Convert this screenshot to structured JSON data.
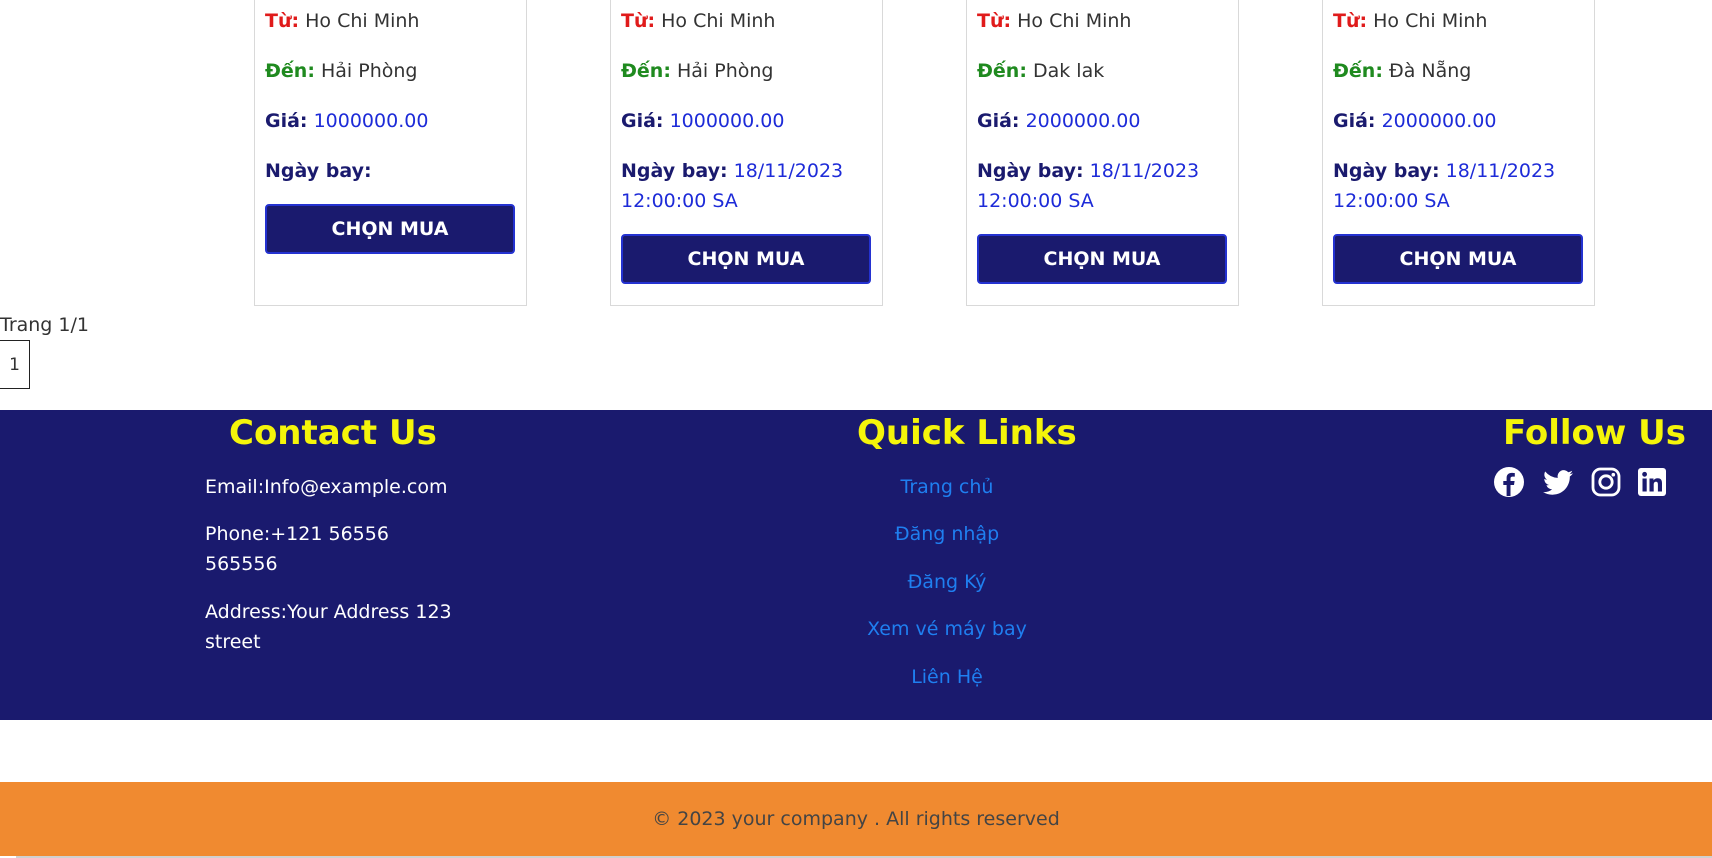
{
  "tickets": [
    {
      "from_label": "Từ:",
      "from": "Ho Chi Minh",
      "to_label": "Đến:",
      "to": "Hải Phòng",
      "price_label": "Giá:",
      "price": "1000000.00",
      "date_label": "Ngày bay:",
      "date": "",
      "button": "CHỌN MUA"
    },
    {
      "from_label": "Từ:",
      "from": "Ho Chi Minh",
      "to_label": "Đến:",
      "to": "Hải Phòng",
      "price_label": "Giá:",
      "price": "1000000.00",
      "date_label": "Ngày bay:",
      "date": "18/11/2023 12:00:00 SA",
      "button": "CHỌN MUA"
    },
    {
      "from_label": "Từ:",
      "from": "Ho Chi Minh",
      "to_label": "Đến:",
      "to": "Dak lak",
      "price_label": "Giá:",
      "price": "2000000.00",
      "date_label": "Ngày bay:",
      "date": "18/11/2023 12:00:00 SA",
      "button": "CHỌN MUA"
    },
    {
      "from_label": "Từ:",
      "from": "Ho Chi Minh",
      "to_label": "Đến:",
      "to": "Đà Nẵng",
      "price_label": "Giá:",
      "price": "2000000.00",
      "date_label": "Ngày bay:",
      "date": "18/11/2023 12:00:00 SA",
      "button": "CHỌN MUA"
    }
  ],
  "pagination": {
    "info": "Trang 1/1",
    "current": "1"
  },
  "footer": {
    "contact": {
      "title": "Contact Us",
      "email": "Email:Info@example.com",
      "phone": "Phone:+121 56556 565556",
      "address": "Address:Your Address 123 street"
    },
    "quick_links": {
      "title": "Quick Links",
      "links": [
        "Trang chủ",
        "Đăng nhập",
        "Đăng Ký",
        "Xem vé máy bay",
        "Liên Hệ"
      ]
    },
    "follow": {
      "title": "Follow Us",
      "icons": [
        "facebook-icon",
        "twitter-icon",
        "instagram-icon",
        "linkedin-icon"
      ]
    }
  },
  "copyright": "© 2023 your company . All rights reserved",
  "colors": {
    "navy": "#1a1a6e",
    "from_label": "#e01b1b",
    "to_label": "#1f8a1f",
    "value_blue": "#1d2bd8",
    "footer_title": "#f5f50a",
    "link": "#1f7ff0",
    "copyright_bar": "#f08a30"
  }
}
